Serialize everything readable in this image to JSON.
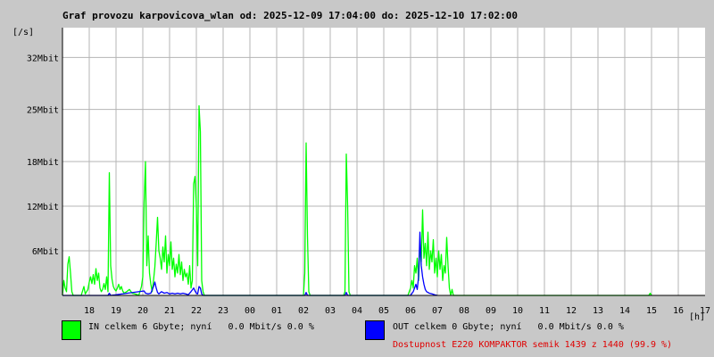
{
  "title": "Graf provozu karpovicova_wlan od: 2025-12-09 17:04:00 do: 2025-12-10 17:02:00",
  "colors": {
    "in": "#00ff00",
    "out": "#0000ff",
    "availability": "#e00000",
    "background": "#c8c8c8",
    "plot_bg": "#ffffff",
    "grid": "#b4b4b4"
  },
  "legend": {
    "in_label": "IN celkem 6 Gbyte; nyní   0.0 Mbit/s 0.0 %",
    "out_label": "OUT celkem 0 Gbyte; nyní   0.0 Mbit/s 0.0 %"
  },
  "availability_text": "Dostupnost E220 KOMPAKTOR semik 1439 z 1440 (99.9 %)",
  "chart_data": {
    "type": "area",
    "title": "Graf provozu karpovicova_wlan od: 2025-12-09 17:04:00 do: 2025-12-10 17:02:00",
    "ylabel": "[/s]",
    "xlabel": "[h]",
    "x_unit": "hours since 17:00",
    "xlim": [
      0,
      24
    ],
    "ylim": [
      0,
      36
    ],
    "x_ticks": [
      {
        "x": 1,
        "label": "18"
      },
      {
        "x": 2,
        "label": "19"
      },
      {
        "x": 3,
        "label": "20"
      },
      {
        "x": 4,
        "label": "21"
      },
      {
        "x": 5,
        "label": "22"
      },
      {
        "x": 6,
        "label": "23"
      },
      {
        "x": 7,
        "label": "00"
      },
      {
        "x": 8,
        "label": "01"
      },
      {
        "x": 9,
        "label": "02"
      },
      {
        "x": 10,
        "label": "03"
      },
      {
        "x": 11,
        "label": "04"
      },
      {
        "x": 12,
        "label": "05"
      },
      {
        "x": 13,
        "label": "06"
      },
      {
        "x": 14,
        "label": "07"
      },
      {
        "x": 15,
        "label": "08"
      },
      {
        "x": 16,
        "label": "09"
      },
      {
        "x": 17,
        "label": "10"
      },
      {
        "x": 18,
        "label": "11"
      },
      {
        "x": 19,
        "label": "12"
      },
      {
        "x": 20,
        "label": "13"
      },
      {
        "x": 21,
        "label": "14"
      },
      {
        "x": 22,
        "label": "15"
      },
      {
        "x": 23,
        "label": "16"
      },
      {
        "x": 24,
        "label": "17"
      }
    ],
    "y_ticks": [
      {
        "y": 6,
        "label": "6Mbit"
      },
      {
        "y": 12,
        "label": "12Mbit"
      },
      {
        "y": 18,
        "label": "18Mbit"
      },
      {
        "y": 25,
        "label": "25Mbit"
      },
      {
        "y": 32,
        "label": "32Mbit"
      }
    ],
    "grid": true,
    "series": [
      {
        "name": "IN",
        "color": "#00ff00",
        "points": [
          [
            0.0,
            0
          ],
          [
            0.05,
            2.0
          ],
          [
            0.1,
            1.0
          ],
          [
            0.15,
            0.5
          ],
          [
            0.2,
            4.2
          ],
          [
            0.25,
            5.2
          ],
          [
            0.3,
            3.0
          ],
          [
            0.35,
            0.5
          ],
          [
            0.4,
            0
          ],
          [
            0.7,
            0
          ],
          [
            0.8,
            1.2
          ],
          [
            0.85,
            0.2
          ],
          [
            0.95,
            0.8
          ],
          [
            1.0,
            1.8
          ],
          [
            1.05,
            2.5
          ],
          [
            1.1,
            1.6
          ],
          [
            1.15,
            2.8
          ],
          [
            1.2,
            1.5
          ],
          [
            1.25,
            3.6
          ],
          [
            1.3,
            2.0
          ],
          [
            1.35,
            3.0
          ],
          [
            1.4,
            1.0
          ],
          [
            1.45,
            0.5
          ],
          [
            1.5,
            0.8
          ],
          [
            1.55,
            1.6
          ],
          [
            1.6,
            0.8
          ],
          [
            1.65,
            2.5
          ],
          [
            1.7,
            0.5
          ],
          [
            1.75,
            16.5
          ],
          [
            1.8,
            4.0
          ],
          [
            1.85,
            2.2
          ],
          [
            1.9,
            1.2
          ],
          [
            1.95,
            0.8
          ],
          [
            2.0,
            0.6
          ],
          [
            2.05,
            1.0
          ],
          [
            2.1,
            1.5
          ],
          [
            2.15,
            0.8
          ],
          [
            2.2,
            1.2
          ],
          [
            2.25,
            0.6
          ],
          [
            2.3,
            0.3
          ],
          [
            2.4,
            0.5
          ],
          [
            2.5,
            0.8
          ],
          [
            2.6,
            0.3
          ],
          [
            2.7,
            0.2
          ],
          [
            2.8,
            0.1
          ],
          [
            2.85,
            0
          ],
          [
            2.95,
            1.2
          ],
          [
            3.0,
            2.5
          ],
          [
            3.05,
            12.5
          ],
          [
            3.1,
            18.0
          ],
          [
            3.15,
            4.0
          ],
          [
            3.2,
            8.0
          ],
          [
            3.25,
            3.0
          ],
          [
            3.3,
            1.5
          ],
          [
            3.35,
            0.5
          ],
          [
            3.4,
            2.0
          ],
          [
            3.45,
            3.8
          ],
          [
            3.5,
            7.0
          ],
          [
            3.55,
            10.5
          ],
          [
            3.6,
            6.0
          ],
          [
            3.65,
            5.0
          ],
          [
            3.7,
            3.5
          ],
          [
            3.75,
            6.5
          ],
          [
            3.8,
            4.5
          ],
          [
            3.85,
            8.0
          ],
          [
            3.9,
            3.0
          ],
          [
            3.95,
            5.5
          ],
          [
            4.0,
            4.0
          ],
          [
            4.05,
            7.2
          ],
          [
            4.1,
            3.5
          ],
          [
            4.15,
            5.0
          ],
          [
            4.2,
            2.5
          ],
          [
            4.25,
            4.2
          ],
          [
            4.3,
            3.0
          ],
          [
            4.35,
            5.5
          ],
          [
            4.4,
            2.8
          ],
          [
            4.45,
            4.5
          ],
          [
            4.5,
            2.0
          ],
          [
            4.55,
            3.5
          ],
          [
            4.6,
            2.5
          ],
          [
            4.65,
            3.0
          ],
          [
            4.7,
            1.5
          ],
          [
            4.75,
            4.0
          ],
          [
            4.8,
            1.0
          ],
          [
            4.85,
            2.0
          ],
          [
            4.9,
            15.0
          ],
          [
            4.95,
            16.0
          ],
          [
            5.0,
            12.0
          ],
          [
            5.05,
            4.0
          ],
          [
            5.1,
            25.5
          ],
          [
            5.15,
            22.0
          ],
          [
            5.2,
            2.0
          ],
          [
            5.25,
            0.5
          ],
          [
            5.3,
            0
          ],
          [
            9.0,
            0
          ],
          [
            9.05,
            3.0
          ],
          [
            9.1,
            20.5
          ],
          [
            9.15,
            8.0
          ],
          [
            9.2,
            0.5
          ],
          [
            9.25,
            0
          ],
          [
            10.5,
            0
          ],
          [
            10.55,
            0.5
          ],
          [
            10.6,
            19.0
          ],
          [
            10.65,
            12.0
          ],
          [
            10.7,
            0.5
          ],
          [
            10.75,
            0
          ],
          [
            12.9,
            0
          ],
          [
            12.95,
            0.5
          ],
          [
            13.0,
            1.0
          ],
          [
            13.05,
            2.0
          ],
          [
            13.1,
            1.0
          ],
          [
            13.15,
            4.0
          ],
          [
            13.2,
            3.0
          ],
          [
            13.25,
            5.0
          ],
          [
            13.3,
            2.0
          ],
          [
            13.35,
            6.5
          ],
          [
            13.4,
            4.5
          ],
          [
            13.45,
            11.5
          ],
          [
            13.5,
            5.0
          ],
          [
            13.55,
            7.0
          ],
          [
            13.6,
            4.0
          ],
          [
            13.65,
            8.5
          ],
          [
            13.7,
            3.5
          ],
          [
            13.75,
            6.0
          ],
          [
            13.8,
            4.5
          ],
          [
            13.85,
            7.5
          ],
          [
            13.9,
            3.0
          ],
          [
            13.95,
            5.0
          ],
          [
            14.0,
            2.5
          ],
          [
            14.05,
            6.0
          ],
          [
            14.1,
            3.5
          ],
          [
            14.15,
            5.5
          ],
          [
            14.2,
            2.0
          ],
          [
            14.25,
            4.0
          ],
          [
            14.3,
            3.0
          ],
          [
            14.35,
            7.8
          ],
          [
            14.4,
            4.0
          ],
          [
            14.45,
            1.0
          ],
          [
            14.5,
            0
          ],
          [
            14.55,
            0.8
          ],
          [
            14.6,
            0
          ],
          [
            21.9,
            0
          ],
          [
            21.95,
            0.3
          ],
          [
            22.0,
            0
          ]
        ]
      },
      {
        "name": "OUT",
        "color": "#0000ff",
        "points": [
          [
            0.0,
            0
          ],
          [
            1.7,
            0
          ],
          [
            1.75,
            0.3
          ],
          [
            1.8,
            0
          ],
          [
            3.05,
            0.6
          ],
          [
            3.1,
            0.3
          ],
          [
            3.2,
            0.2
          ],
          [
            3.3,
            0.3
          ],
          [
            3.4,
            1.2
          ],
          [
            3.45,
            1.8
          ],
          [
            3.5,
            1.0
          ],
          [
            3.55,
            0.4
          ],
          [
            3.6,
            0.2
          ],
          [
            3.7,
            0.5
          ],
          [
            3.8,
            0.3
          ],
          [
            3.9,
            0.4
          ],
          [
            4.0,
            0.2
          ],
          [
            4.1,
            0.3
          ],
          [
            4.2,
            0.2
          ],
          [
            4.3,
            0.3
          ],
          [
            4.4,
            0.2
          ],
          [
            4.5,
            0.3
          ],
          [
            4.6,
            0.2
          ],
          [
            4.7,
            0.1
          ],
          [
            4.8,
            0.5
          ],
          [
            4.9,
            1.0
          ],
          [
            4.95,
            0.6
          ],
          [
            5.0,
            0.3
          ],
          [
            5.05,
            0.2
          ],
          [
            5.1,
            1.2
          ],
          [
            5.15,
            1.0
          ],
          [
            5.2,
            0.2
          ],
          [
            5.25,
            0
          ],
          [
            9.05,
            0
          ],
          [
            9.1,
            0.4
          ],
          [
            9.15,
            0
          ],
          [
            10.55,
            0
          ],
          [
            10.6,
            0.4
          ],
          [
            10.65,
            0
          ],
          [
            13.0,
            0
          ],
          [
            13.1,
            0.5
          ],
          [
            13.2,
            1.5
          ],
          [
            13.25,
            0.8
          ],
          [
            13.3,
            2.5
          ],
          [
            13.35,
            8.5
          ],
          [
            13.4,
            4.0
          ],
          [
            13.45,
            2.5
          ],
          [
            13.5,
            1.5
          ],
          [
            13.55,
            0.8
          ],
          [
            13.6,
            0.5
          ],
          [
            13.7,
            0.3
          ],
          [
            13.8,
            0.2
          ],
          [
            13.9,
            0.1
          ],
          [
            14.0,
            0
          ]
        ]
      }
    ]
  }
}
